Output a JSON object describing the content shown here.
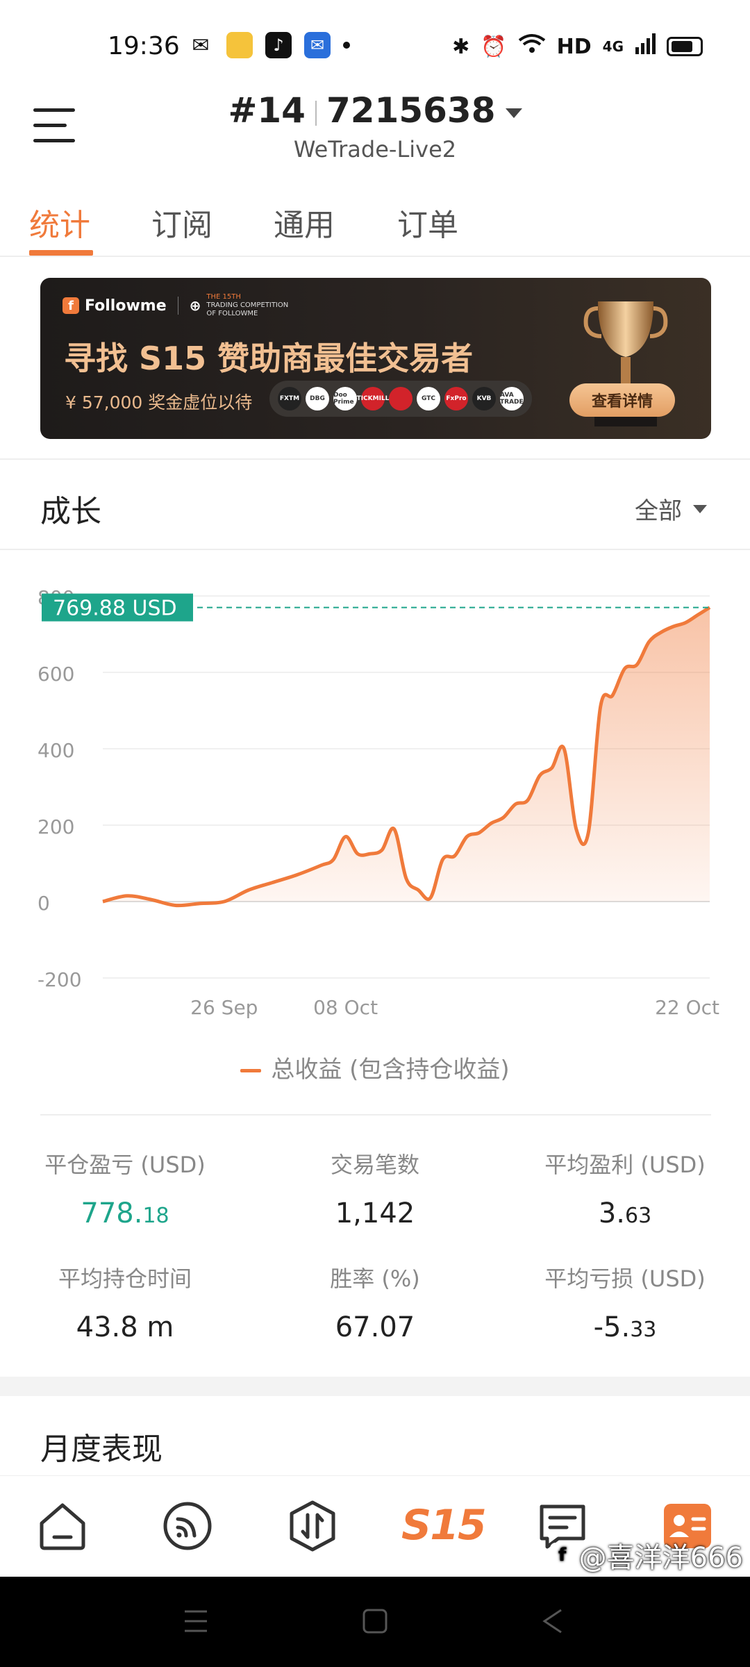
{
  "status_bar": {
    "time": "19:36",
    "network_text": "HD",
    "signal_text": "4G"
  },
  "header": {
    "rank": "#14",
    "account": "7215638",
    "server": "WeTrade-Live2"
  },
  "tabs": [
    {
      "label": "统计",
      "active": true
    },
    {
      "label": "订阅",
      "active": false
    },
    {
      "label": "通用",
      "active": false
    },
    {
      "label": "订单",
      "active": false
    }
  ],
  "banner": {
    "brand": "Followme",
    "brand_small_1": "THE 15TH",
    "brand_small_2": "TRADING COMPETITION",
    "brand_small_3": "OF FOLLOWME",
    "headline": "寻找 S15 赞助商最佳交易者",
    "prize": "¥ 57,000 奖金虚位以待",
    "sponsors": [
      "FXTM",
      "DBG",
      "Doo Prime",
      "TICKMILL",
      "",
      "GTC",
      "FxPro",
      "KVB",
      "AVA TRADE"
    ],
    "button": "查看详情"
  },
  "growth": {
    "title": "成长",
    "filter": "全部",
    "current_value_label": "769.88 USD",
    "legend": "总收益 (包含持仓收益)"
  },
  "chart_data": {
    "type": "area",
    "title": "",
    "ylim": [
      -200,
      800
    ],
    "yticks": [
      -200,
      0,
      200,
      400,
      600,
      800
    ],
    "ytick_labels": [
      "-200",
      "0",
      "200",
      "400",
      "600",
      "800"
    ],
    "xtick_labels": [
      "26 Sep",
      "08 Oct",
      "22 Oct"
    ],
    "reference_line": 769.88,
    "series": [
      {
        "name": "总收益 (包含持仓收益)",
        "color": "#f07a3b",
        "x": [
          0,
          0.04,
          0.08,
          0.12,
          0.16,
          0.2,
          0.24,
          0.28,
          0.32,
          0.36,
          0.38,
          0.4,
          0.42,
          0.44,
          0.46,
          0.48,
          0.5,
          0.52,
          0.54,
          0.56,
          0.58,
          0.6,
          0.62,
          0.64,
          0.66,
          0.68,
          0.7,
          0.72,
          0.74,
          0.76,
          0.78,
          0.8,
          0.82,
          0.84,
          0.86,
          0.88,
          0.9,
          0.92,
          0.94,
          0.96,
          0.98,
          1.0
        ],
        "values": [
          0,
          15,
          5,
          -10,
          -5,
          0,
          30,
          50,
          70,
          95,
          110,
          170,
          125,
          125,
          135,
          190,
          60,
          30,
          10,
          110,
          120,
          170,
          180,
          205,
          220,
          255,
          265,
          330,
          350,
          400,
          190,
          180,
          510,
          540,
          610,
          620,
          680,
          705,
          720,
          730,
          750,
          769.88
        ]
      }
    ]
  },
  "stats": [
    {
      "label": "平仓盈亏 (USD)",
      "value_main": "778.",
      "value_small": "18",
      "green": true
    },
    {
      "label": "交易笔数",
      "value_main": "1,142",
      "value_small": "",
      "green": false
    },
    {
      "label": "平均盈利 (USD)",
      "value_main": "3.",
      "value_small": "63",
      "green": false
    },
    {
      "label": "平均持仓时间",
      "value_main": "43.8 m",
      "value_small": "",
      "green": false
    },
    {
      "label": "胜率 (%)",
      "value_main": "67.07",
      "value_small": "",
      "green": false
    },
    {
      "label": "平均亏损 (USD)",
      "value_main": "-5.",
      "value_small": "33",
      "green": false
    }
  ],
  "monthly": {
    "title": "月度表现"
  },
  "bottom_nav": {
    "s15": "S15"
  },
  "watermark": "@喜洋洋666",
  "colors": {
    "accent": "#f07a3b",
    "green": "#1ea58b",
    "value_label_bg": "#1ea58b"
  }
}
